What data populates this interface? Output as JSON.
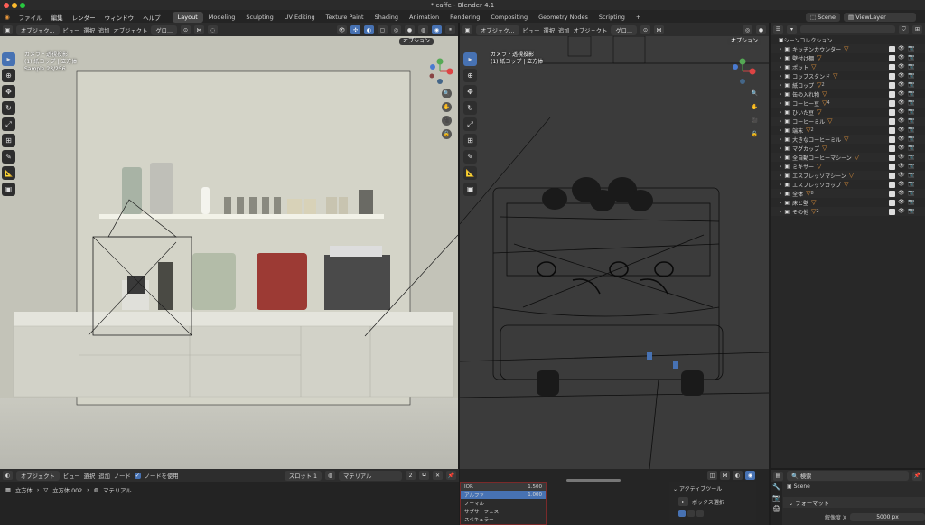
{
  "window_title": "* caffe - Blender 4.1",
  "menu": [
    "ファイル",
    "編集",
    "レンダー",
    "ウィンドウ",
    "ヘルプ"
  ],
  "workspaces": [
    "Layout",
    "Modeling",
    "Sculpting",
    "UV Editing",
    "Texture Paint",
    "Shading",
    "Animation",
    "Rendering",
    "Compositing",
    "Geometry Nodes",
    "Scripting"
  ],
  "active_workspace": "Layout",
  "add_tab": "+",
  "scene_name": "Scene",
  "view_layer": "ViewLayer",
  "viewport_left": {
    "mode": "オブジェク...",
    "menus": [
      "ビュー",
      "選択",
      "追加",
      "オブジェクト"
    ],
    "transform": "グロ...",
    "options": "オプション",
    "overlay_lines": [
      "カメラ・透視投影",
      "(1) 紙コップ | 立方体",
      "Sample 23/256"
    ]
  },
  "viewport_right": {
    "mode": "オブジェク...",
    "menus": [
      "ビュー",
      "選択",
      "追加",
      "オブジェクト"
    ],
    "transform": "グロ...",
    "options": "オプション",
    "overlay_lines": [
      "カメラ・透視投影",
      "(1) 紙コップ | 立方体"
    ]
  },
  "outliner": {
    "search_placeholder": "",
    "root": "シーンコレクション",
    "items": [
      "キッチンカウンター",
      "壁付け棚",
      "ポット",
      "コップスタンド",
      "紙コップ",
      "缶の入れ物",
      "コーヒー豆",
      "ひいた豆",
      "コーヒーミル",
      "端末",
      "大きなコーヒーミル",
      "マグカップ",
      "全自動コーヒーマシーン",
      "ミキサー",
      "エスプレッソマシーン",
      "エスプレッソカップ",
      "全体",
      "床と壁",
      "その他"
    ],
    "badges": [
      "",
      "",
      "",
      "",
      "2",
      "",
      "4",
      "",
      "",
      "2",
      "",
      "",
      "",
      "",
      "",
      "",
      "8",
      "",
      "2"
    ]
  },
  "node_editor": {
    "mode": "オブジェクト",
    "menus": [
      "ビュー",
      "選択",
      "追加",
      "ノード"
    ],
    "use_nodes_label": "ノードを使用",
    "slot": "スロット 1",
    "material": "マテリアル",
    "material_users": "2",
    "breadcrumb": [
      "立方体",
      "立方体.002",
      "マテリアル"
    ]
  },
  "material_panel": {
    "rows": [
      {
        "label": "IOR",
        "value": "1.500"
      },
      {
        "label": "アルファ",
        "value": "1.000"
      },
      {
        "label": "ノーマル",
        "value": ""
      },
      {
        "label": "サブサーフェス",
        "value": ""
      },
      {
        "label": "スペキュラー",
        "value": ""
      }
    ],
    "active_tool_header": "アクティブツール",
    "tool_name": "ボックス選択"
  },
  "properties": {
    "search_placeholder": "検索",
    "scene_label": "Scene",
    "section": "フォーマット",
    "resolution_label": "解像度 X",
    "resolution_value": "5000 px"
  },
  "colors": {
    "accent": "#4772b3",
    "outliner_icon": "#e8963b"
  }
}
